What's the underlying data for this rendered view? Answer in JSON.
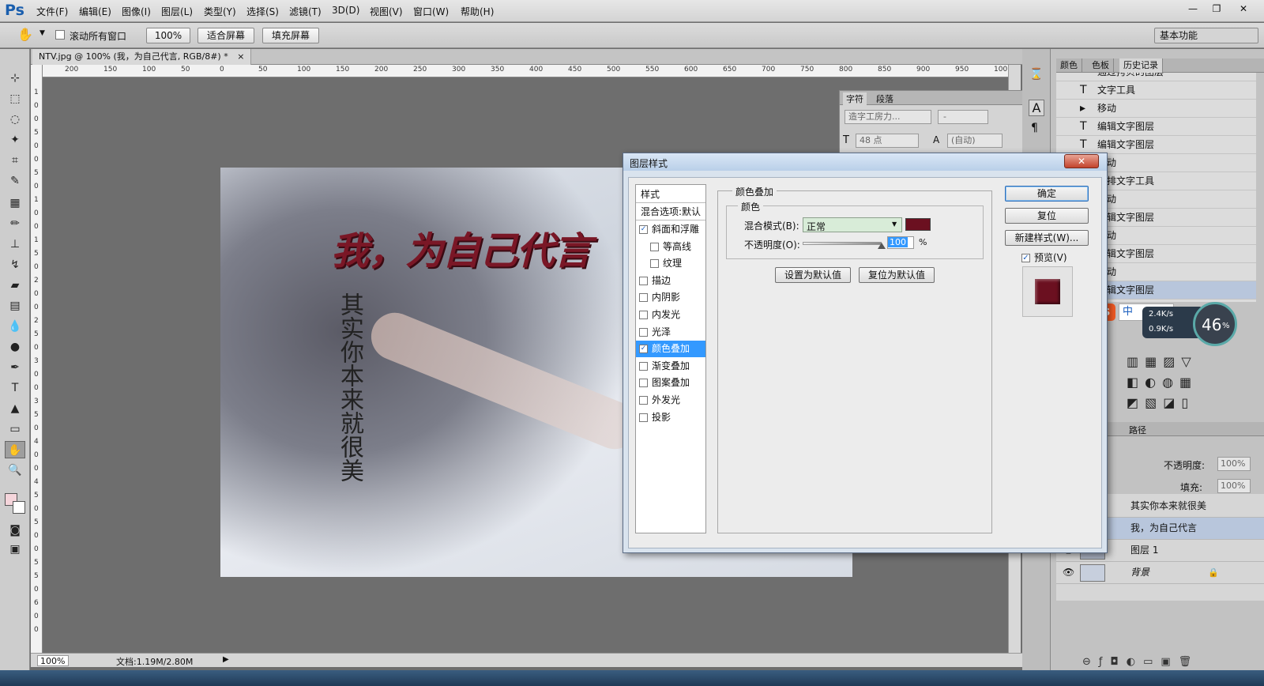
{
  "app": {
    "logo": "Ps"
  },
  "menu": [
    "文件(F)",
    "编辑(E)",
    "图像(I)",
    "图层(L)",
    "类型(Y)",
    "选择(S)",
    "滤镜(T)",
    "3D(D)",
    "视图(V)",
    "窗口(W)",
    "帮助(H)"
  ],
  "window_controls": {
    "minimize": "—",
    "restore": "❐",
    "close": "✕"
  },
  "options": {
    "scroll_all_label": "滚动所有窗口",
    "zoom_value": "100%",
    "fit_screen": "适合屏幕",
    "fill_screen": "填充屏幕",
    "workspace": "基本功能"
  },
  "document": {
    "tab_title": "NTV.jpg @ 100% (我，为自己代言, RGB/8#) *",
    "tab_close": "×",
    "headline": "我，为自己代言",
    "vertical_text": "其实你本来就很美"
  },
  "ruler": {
    "h": [
      "200",
      "150",
      "100",
      "50",
      "0",
      "50",
      "100",
      "150",
      "200",
      "250",
      "300",
      "350",
      "400",
      "450",
      "500",
      "550",
      "600",
      "650",
      "700",
      "750",
      "800",
      "850",
      "900",
      "950",
      "100"
    ],
    "v": [
      "1",
      "0",
      "0",
      "5",
      "0",
      "0",
      "5",
      "0",
      "1",
      "0",
      "0",
      "1",
      "5",
      "0",
      "2",
      "0",
      "0",
      "2",
      "5",
      "0",
      "3",
      "0",
      "0",
      "3",
      "5",
      "0",
      "4",
      "0",
      "0",
      "4",
      "5",
      "0",
      "5",
      "0",
      "0",
      "5",
      "5",
      "0",
      "6",
      "0",
      "0"
    ]
  },
  "status": {
    "zoom": "100%",
    "doc": "文档:1.19M/2.80M",
    "arrow": "▶"
  },
  "char_panel": {
    "tabs": [
      "字符",
      "段落"
    ],
    "font_family": "造字工房力...",
    "font_style": "-",
    "font_size": "48 点",
    "leading": "(自动)"
  },
  "history": {
    "tabs": [
      "颜色",
      "色板",
      "历史记录"
    ],
    "items": [
      {
        "icon": "",
        "label": "通过拷贝的图层"
      },
      {
        "icon": "T",
        "label": "文字工具"
      },
      {
        "icon": "▸",
        "label": "移动"
      },
      {
        "icon": "T",
        "label": "编辑文字图层"
      },
      {
        "icon": "T",
        "label": "编辑文字图层"
      },
      {
        "icon": "",
        "label": "移动"
      },
      {
        "icon": "",
        "label": "直排文字工具"
      },
      {
        "icon": "",
        "label": "移动"
      },
      {
        "icon": "",
        "label": "编辑文字图层"
      },
      {
        "icon": "",
        "label": "移动"
      },
      {
        "icon": "",
        "label": "编辑文字图层"
      },
      {
        "icon": "",
        "label": "移动"
      },
      {
        "icon": "",
        "label": "编辑文字图层"
      }
    ]
  },
  "layers": {
    "tab_label": "路径",
    "opacity_label": "不透明度:",
    "opacity_value": "100%",
    "fill_label": "填充:",
    "fill_value": "100%",
    "items": [
      {
        "label": "其实你本来就很美",
        "thumb": "T"
      },
      {
        "label": "我，为自己代言",
        "thumb": "T"
      },
      {
        "label": "图层 1",
        "thumb": ""
      },
      {
        "label": "背景",
        "thumb": ""
      }
    ]
  },
  "dialog": {
    "title": "图层样式",
    "close": "✕",
    "styles_header": "样式",
    "blend_options": "混合选项:默认",
    "styles": [
      {
        "label": "斜面和浮雕",
        "checked": true,
        "indent": false
      },
      {
        "label": "等高线",
        "checked": false,
        "indent": true
      },
      {
        "label": "纹理",
        "checked": false,
        "indent": true
      },
      {
        "label": "描边",
        "checked": false,
        "indent": false
      },
      {
        "label": "内阴影",
        "checked": false,
        "indent": false
      },
      {
        "label": "内发光",
        "checked": false,
        "indent": false
      },
      {
        "label": "光泽",
        "checked": false,
        "indent": false
      },
      {
        "label": "颜色叠加",
        "checked": true,
        "indent": false,
        "selected": true
      },
      {
        "label": "渐变叠加",
        "checked": false,
        "indent": false
      },
      {
        "label": "图案叠加",
        "checked": false,
        "indent": false
      },
      {
        "label": "外发光",
        "checked": false,
        "indent": false
      },
      {
        "label": "投影",
        "checked": false,
        "indent": false
      }
    ],
    "section_title": "颜色叠加",
    "subsection_title": "颜色",
    "blend_mode_label": "混合模式(B):",
    "blend_mode_value": "正常",
    "overlay_color": "#6b1020",
    "opacity_label": "不透明度(O):",
    "opacity_value": "100",
    "opacity_unit": "%",
    "opacity_fraction": 1.0,
    "make_default": "设置为默认值",
    "reset_default": "复位为默认值",
    "ok": "确定",
    "reset": "复位",
    "new_style": "新建样式(W)...",
    "preview_label": "预览(V)",
    "preview_checked": true
  },
  "ime": {
    "logo": "S",
    "mode": "中",
    "up": "2.4K/s",
    "down": "0.9K/s",
    "percent": "46",
    "pct_sign": "%"
  },
  "colors": {
    "accent": "#3399ff",
    "headline": "#7a1726",
    "selection": "#3399ff"
  }
}
